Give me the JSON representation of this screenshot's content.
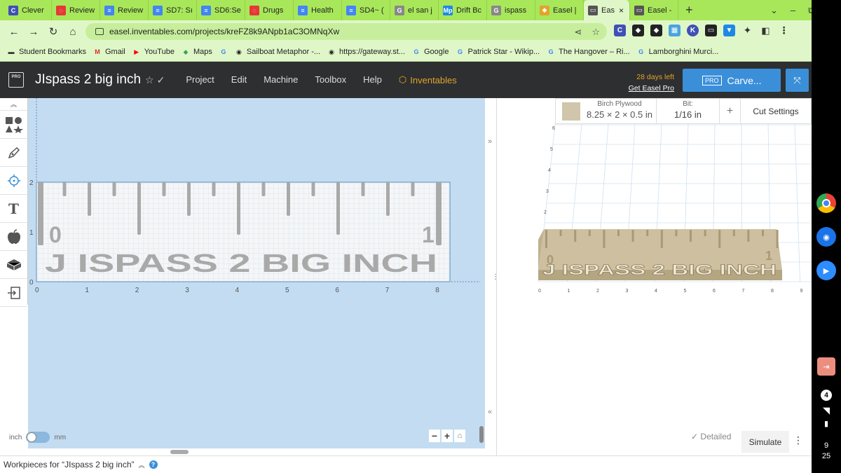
{
  "browser": {
    "tabs": [
      {
        "label": "Clever",
        "color": "#3f51b5",
        "glyph": "C"
      },
      {
        "label": "Review",
        "color": "#e53935",
        "glyph": "◌"
      },
      {
        "label": "Review",
        "color": "#4285f4",
        "glyph": "≡"
      },
      {
        "label": "SD7: Sı",
        "color": "#4285f4",
        "glyph": "≡"
      },
      {
        "label": "SD6:Se",
        "color": "#4285f4",
        "glyph": "≡"
      },
      {
        "label": "Drugs",
        "color": "#e53935",
        "glyph": "◌"
      },
      {
        "label": "Health",
        "color": "#4285f4",
        "glyph": "≡"
      },
      {
        "label": "SD4~ (",
        "color": "#4285f4",
        "glyph": "≡"
      },
      {
        "label": "el san j",
        "color": "#888888",
        "glyph": "G"
      },
      {
        "label": "Drift Bc",
        "color": "#1e88e5",
        "glyph": "Mp"
      },
      {
        "label": "ispass",
        "color": "#888888",
        "glyph": "G"
      },
      {
        "label": "Easel |",
        "color": "#e3a32a",
        "glyph": "◆"
      },
      {
        "label": "Eas",
        "color": "#555555",
        "glyph": "▭",
        "active": true
      },
      {
        "label": "Easel -",
        "color": "#555555",
        "glyph": "▭"
      }
    ],
    "close_tab": "×",
    "new_tab": "+",
    "window_controls": [
      "⌄",
      "–",
      "⧉",
      "×"
    ],
    "url": "easel.inventables.com/projects/kreFZ8k9ANpb1aC3OMNqXw",
    "bookmarks": [
      {
        "label": "Student Bookmarks",
        "icon": "folder-icon"
      },
      {
        "label": "Gmail",
        "icon": "gmail-icon"
      },
      {
        "label": "YouTube",
        "icon": "youtube-icon"
      },
      {
        "label": "Maps",
        "icon": "maps-icon"
      },
      {
        "label": "",
        "icon": "google-icon"
      },
      {
        "label": "Sailboat Metaphor -...",
        "icon": "globe-icon"
      },
      {
        "label": "https://gateway.st...",
        "icon": "globe-icon"
      },
      {
        "label": "Google",
        "icon": "google-icon"
      },
      {
        "label": "Patrick Star - Wikip...",
        "icon": "google-icon"
      },
      {
        "label": "The Hangover – Ri...",
        "icon": "google-icon"
      },
      {
        "label": "Lamborghini Murci...",
        "icon": "google-icon"
      }
    ]
  },
  "app": {
    "logo_text": "PRO",
    "title": "JIspass 2 big inch",
    "menu": [
      "Project",
      "Edit",
      "Machine",
      "Toolbox",
      "Help"
    ],
    "inventables_label": "Inventables",
    "trial_days": "28 days left",
    "trial_link": "Get Easel Pro",
    "carve_badge": "PRO",
    "carve_label": "Carve...",
    "accent_color": "#3b8fd9"
  },
  "tools": [
    "collapse-icon",
    "shapes-icon",
    "pen-icon",
    "target-icon",
    "text-icon",
    "apple-icon",
    "box-icon",
    "import-icon"
  ],
  "canvas": {
    "unit_inch": "inch",
    "unit_mm": "mm",
    "x_ticks": [
      "0",
      "1",
      "2",
      "3",
      "4",
      "5",
      "6",
      "7",
      "8"
    ],
    "y_ticks": [
      "0",
      "1",
      "2"
    ],
    "workpiece_text": "J ISPASS 2 BIG INCH",
    "num_left": "0",
    "num_right": "1"
  },
  "material": {
    "name": "Birch Plywood",
    "dims": "8.25 × 2 × 0.5 in",
    "bit_label": "Bit:",
    "bit_value": "1/16 in",
    "cut_settings": "Cut Settings"
  },
  "preview": {
    "x_ticks": [
      "0",
      "1",
      "2",
      "3",
      "4",
      "5",
      "6",
      "7",
      "8",
      "9"
    ],
    "y_ticks": [
      "2",
      "3",
      "4",
      "5",
      "6"
    ],
    "detailed_label": "Detailed",
    "simulate_label": "Simulate"
  },
  "footer": {
    "workpieces_label": "Workpieces for “JIspass 2 big inch”"
  },
  "shelf": {
    "notif_count": "4",
    "time_h": "9",
    "time_m": "25"
  }
}
